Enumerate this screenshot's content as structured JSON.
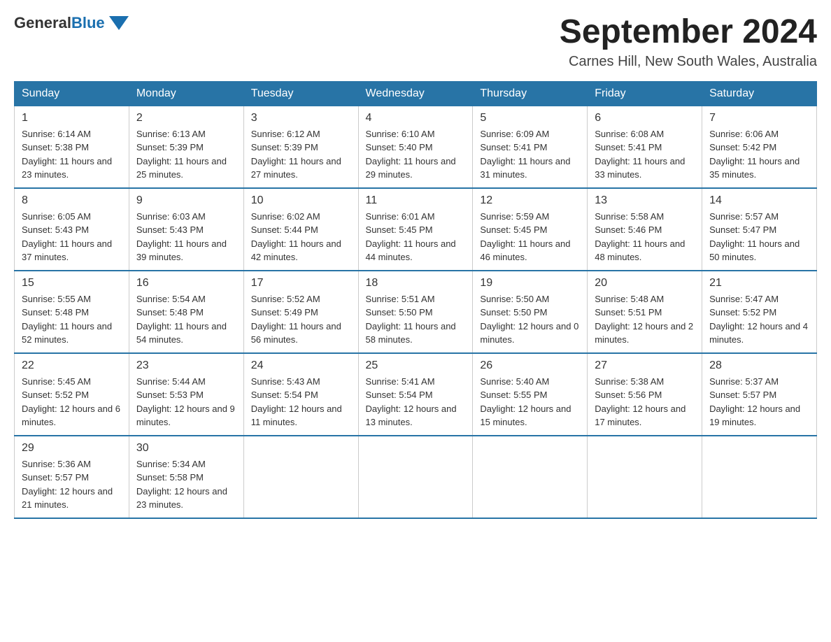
{
  "logo": {
    "general": "General",
    "blue": "Blue"
  },
  "title": "September 2024",
  "subtitle": "Carnes Hill, New South Wales, Australia",
  "days_of_week": [
    "Sunday",
    "Monday",
    "Tuesday",
    "Wednesday",
    "Thursday",
    "Friday",
    "Saturday"
  ],
  "weeks": [
    [
      {
        "day": "1",
        "sunrise": "6:14 AM",
        "sunset": "5:38 PM",
        "daylight": "11 hours and 23 minutes."
      },
      {
        "day": "2",
        "sunrise": "6:13 AM",
        "sunset": "5:39 PM",
        "daylight": "11 hours and 25 minutes."
      },
      {
        "day": "3",
        "sunrise": "6:12 AM",
        "sunset": "5:39 PM",
        "daylight": "11 hours and 27 minutes."
      },
      {
        "day": "4",
        "sunrise": "6:10 AM",
        "sunset": "5:40 PM",
        "daylight": "11 hours and 29 minutes."
      },
      {
        "day": "5",
        "sunrise": "6:09 AM",
        "sunset": "5:41 PM",
        "daylight": "11 hours and 31 minutes."
      },
      {
        "day": "6",
        "sunrise": "6:08 AM",
        "sunset": "5:41 PM",
        "daylight": "11 hours and 33 minutes."
      },
      {
        "day": "7",
        "sunrise": "6:06 AM",
        "sunset": "5:42 PM",
        "daylight": "11 hours and 35 minutes."
      }
    ],
    [
      {
        "day": "8",
        "sunrise": "6:05 AM",
        "sunset": "5:43 PM",
        "daylight": "11 hours and 37 minutes."
      },
      {
        "day": "9",
        "sunrise": "6:03 AM",
        "sunset": "5:43 PM",
        "daylight": "11 hours and 39 minutes."
      },
      {
        "day": "10",
        "sunrise": "6:02 AM",
        "sunset": "5:44 PM",
        "daylight": "11 hours and 42 minutes."
      },
      {
        "day": "11",
        "sunrise": "6:01 AM",
        "sunset": "5:45 PM",
        "daylight": "11 hours and 44 minutes."
      },
      {
        "day": "12",
        "sunrise": "5:59 AM",
        "sunset": "5:45 PM",
        "daylight": "11 hours and 46 minutes."
      },
      {
        "day": "13",
        "sunrise": "5:58 AM",
        "sunset": "5:46 PM",
        "daylight": "11 hours and 48 minutes."
      },
      {
        "day": "14",
        "sunrise": "5:57 AM",
        "sunset": "5:47 PM",
        "daylight": "11 hours and 50 minutes."
      }
    ],
    [
      {
        "day": "15",
        "sunrise": "5:55 AM",
        "sunset": "5:48 PM",
        "daylight": "11 hours and 52 minutes."
      },
      {
        "day": "16",
        "sunrise": "5:54 AM",
        "sunset": "5:48 PM",
        "daylight": "11 hours and 54 minutes."
      },
      {
        "day": "17",
        "sunrise": "5:52 AM",
        "sunset": "5:49 PM",
        "daylight": "11 hours and 56 minutes."
      },
      {
        "day": "18",
        "sunrise": "5:51 AM",
        "sunset": "5:50 PM",
        "daylight": "11 hours and 58 minutes."
      },
      {
        "day": "19",
        "sunrise": "5:50 AM",
        "sunset": "5:50 PM",
        "daylight": "12 hours and 0 minutes."
      },
      {
        "day": "20",
        "sunrise": "5:48 AM",
        "sunset": "5:51 PM",
        "daylight": "12 hours and 2 minutes."
      },
      {
        "day": "21",
        "sunrise": "5:47 AM",
        "sunset": "5:52 PM",
        "daylight": "12 hours and 4 minutes."
      }
    ],
    [
      {
        "day": "22",
        "sunrise": "5:45 AM",
        "sunset": "5:52 PM",
        "daylight": "12 hours and 6 minutes."
      },
      {
        "day": "23",
        "sunrise": "5:44 AM",
        "sunset": "5:53 PM",
        "daylight": "12 hours and 9 minutes."
      },
      {
        "day": "24",
        "sunrise": "5:43 AM",
        "sunset": "5:54 PM",
        "daylight": "12 hours and 11 minutes."
      },
      {
        "day": "25",
        "sunrise": "5:41 AM",
        "sunset": "5:54 PM",
        "daylight": "12 hours and 13 minutes."
      },
      {
        "day": "26",
        "sunrise": "5:40 AM",
        "sunset": "5:55 PM",
        "daylight": "12 hours and 15 minutes."
      },
      {
        "day": "27",
        "sunrise": "5:38 AM",
        "sunset": "5:56 PM",
        "daylight": "12 hours and 17 minutes."
      },
      {
        "day": "28",
        "sunrise": "5:37 AM",
        "sunset": "5:57 PM",
        "daylight": "12 hours and 19 minutes."
      }
    ],
    [
      {
        "day": "29",
        "sunrise": "5:36 AM",
        "sunset": "5:57 PM",
        "daylight": "12 hours and 21 minutes."
      },
      {
        "day": "30",
        "sunrise": "5:34 AM",
        "sunset": "5:58 PM",
        "daylight": "12 hours and 23 minutes."
      },
      null,
      null,
      null,
      null,
      null
    ]
  ],
  "labels": {
    "sunrise": "Sunrise:",
    "sunset": "Sunset:",
    "daylight": "Daylight:"
  }
}
